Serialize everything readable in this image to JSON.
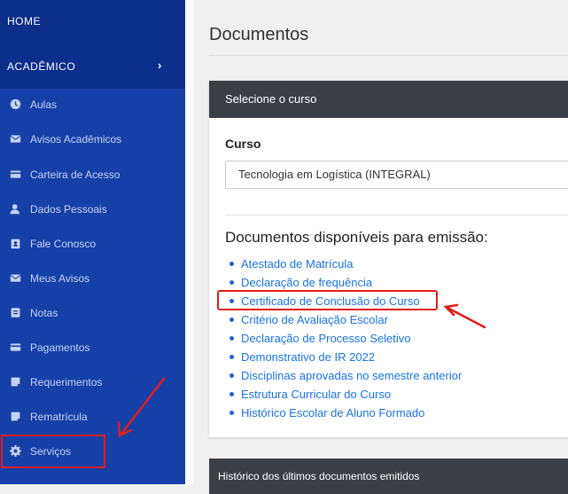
{
  "sidebar": {
    "home": "HOME",
    "academico": "ACADÊMICO",
    "items": [
      {
        "label": "Aulas",
        "icon": "clock-icon"
      },
      {
        "label": "Avisos Acadêmicos",
        "icon": "envelope-icon"
      },
      {
        "label": "Carteira de Acesso",
        "icon": "card-icon"
      },
      {
        "label": "Dados Pessoais",
        "icon": "user-icon"
      },
      {
        "label": "Fale Conosco",
        "icon": "contact-icon"
      },
      {
        "label": "Meus Avisos",
        "icon": "envelope-icon"
      },
      {
        "label": "Notas",
        "icon": "book-icon"
      },
      {
        "label": "Pagamentos",
        "icon": "card-icon"
      },
      {
        "label": "Requerimentos",
        "icon": "document-icon"
      },
      {
        "label": "Rematrícula",
        "icon": "document-icon"
      },
      {
        "label": "Serviços",
        "icon": "gear-icon"
      }
    ]
  },
  "main": {
    "title": "Documentos",
    "card": {
      "header": "Selecione o curso",
      "curso_label": "Curso",
      "curso_value": "Tecnologia em Logística (INTEGRAL)",
      "docs_heading": "Documentos disponíveis para emissão:",
      "documents": [
        "Atestado de Matrícula",
        "Declaração de frequência",
        "Certificado de Conclusão do Curso",
        "Critério de Avaliação Escolar",
        "Declaração de Processo Seletivo",
        "Demonstrativo de IR 2022",
        "Disciplinas aprovadas no semestre anterior",
        "Estrutura Curricular do Curso",
        "Histórico Escolar de Aluno Formado"
      ]
    },
    "history_header": "Histórico dos últimos documentos emitidos"
  },
  "annotations": {
    "highlight_color": "#e21b1b"
  }
}
